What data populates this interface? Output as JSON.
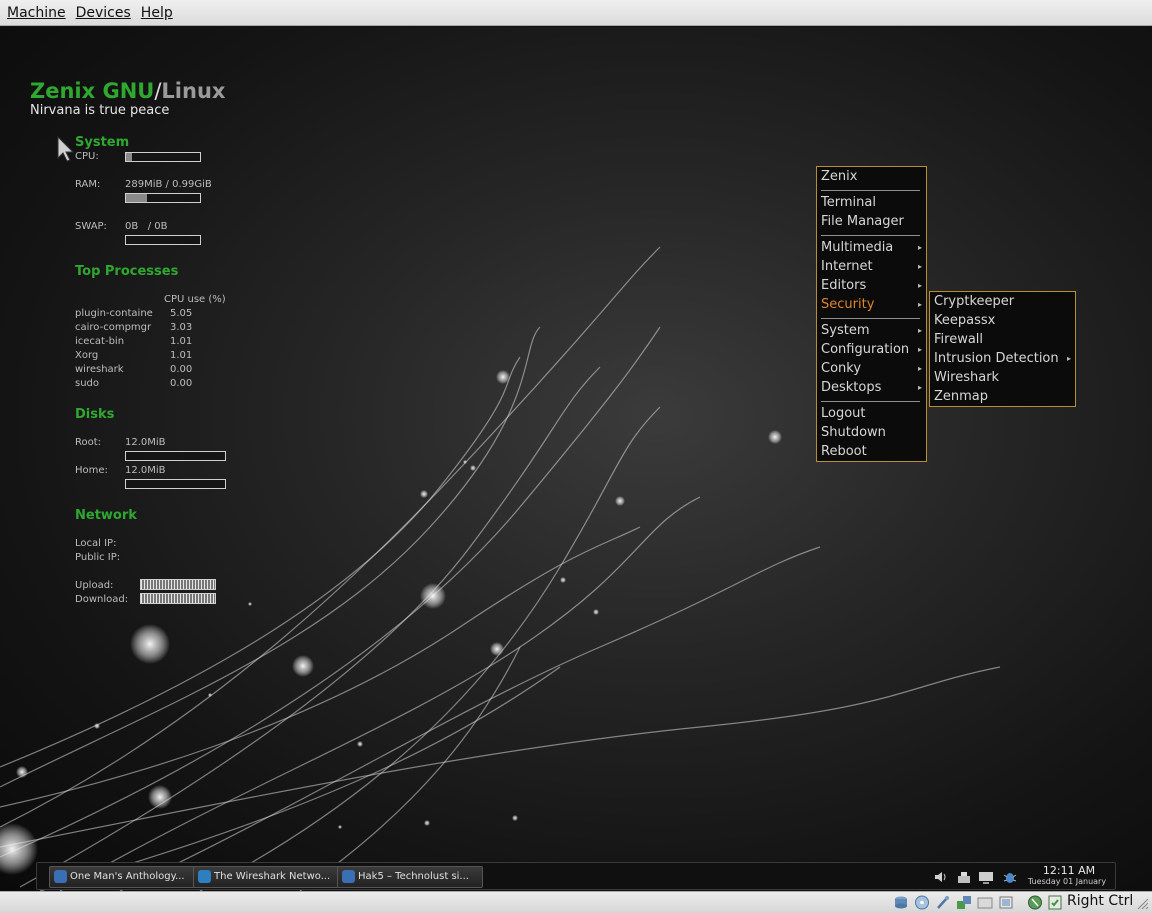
{
  "host_menubar": {
    "machine": "Machine",
    "devices": "Devices",
    "help": "Help"
  },
  "conky": {
    "brand_main": "Zenix GNU",
    "brand_sep": "/",
    "brand_os": "Linux",
    "tagline": "Nirvana is true peace",
    "system": {
      "title": "System",
      "cpu_label": "CPU:",
      "cpu_usage": 0.08,
      "ram_label": "RAM:",
      "ram_value": "289MiB / 0.99GiB",
      "ram_usage": 0.28,
      "swap_label": "SWAP:",
      "swap_value": "0B   / 0B",
      "swap_usage": 0
    },
    "top_processes": {
      "title": "Top Processes",
      "header": "CPU use (%)",
      "rows": [
        {
          "name": "plugin-containe",
          "cpu": "5.05"
        },
        {
          "name": "cairo-compmgr",
          "cpu": "3.03"
        },
        {
          "name": "icecat-bin",
          "cpu": "1.01"
        },
        {
          "name": "Xorg",
          "cpu": "1.01"
        },
        {
          "name": "wireshark",
          "cpu": "0.00"
        },
        {
          "name": "sudo",
          "cpu": "0.00"
        }
      ]
    },
    "disks": {
      "title": "Disks",
      "root_label": "Root:",
      "root_value": "12.0MiB",
      "root_usage": 0,
      "home_label": "Home:",
      "home_value": "12.0MiB",
      "home_usage": 0
    },
    "network": {
      "title": "Network",
      "local_ip_label": "Local IP:",
      "public_ip_label": "Public IP:",
      "upload_label": "Upload:",
      "download_label": "Download:"
    }
  },
  "main_menu": {
    "items": [
      {
        "label": "Zenix",
        "submenu": false
      },
      {
        "label": "Terminal",
        "submenu": false
      },
      {
        "label": "File Manager",
        "submenu": false
      },
      {
        "label": "Multimedia",
        "submenu": true
      },
      {
        "label": "Internet",
        "submenu": true
      },
      {
        "label": "Editors",
        "submenu": true
      },
      {
        "label": "Security",
        "submenu": true,
        "active": true
      },
      {
        "label": "System",
        "submenu": true
      },
      {
        "label": "Configuration",
        "submenu": true
      },
      {
        "label": "Conky",
        "submenu": true
      },
      {
        "label": "Desktops",
        "submenu": true
      },
      {
        "label": "Logout",
        "submenu": false
      },
      {
        "label": "Shutdown",
        "submenu": false
      },
      {
        "label": "Reboot",
        "submenu": false
      }
    ]
  },
  "security_menu": {
    "items": [
      {
        "label": "Cryptkeeper",
        "submenu": false
      },
      {
        "label": "Keepassx",
        "submenu": false
      },
      {
        "label": "Firewall",
        "submenu": false
      },
      {
        "label": "Intrusion Detection",
        "submenu": true
      },
      {
        "label": "Wireshark",
        "submenu": false
      },
      {
        "label": "Zenmap",
        "submenu": false
      }
    ]
  },
  "taskbar": {
    "tasks": [
      {
        "label": "One Man's Anthology...",
        "icon": "browser-icon"
      },
      {
        "label": "The Wireshark Netwo...",
        "icon": "wireshark-icon"
      },
      {
        "label": "Hak5 – Technolust si...",
        "icon": "browser-icon"
      }
    ],
    "clock_time": "12:11 AM",
    "clock_date": "Tuesday 01 January"
  },
  "vb_status": {
    "host_key": "Right Ctrl"
  },
  "colors": {
    "accent_green": "#2fa830",
    "menu_border": "#b98d34",
    "menu_active": "#e0842a"
  },
  "arrow_glyph": "▸"
}
